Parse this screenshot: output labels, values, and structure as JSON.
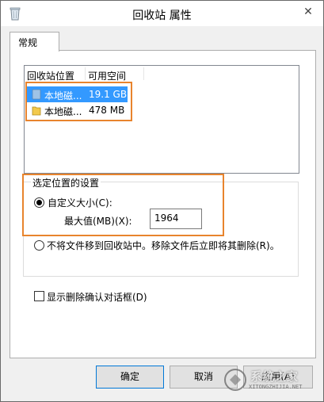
{
  "window": {
    "title": "回收站 属性",
    "close_glyph": "✕"
  },
  "tabs": [
    {
      "label": "常规"
    }
  ],
  "listview": {
    "columns": [
      "回收站位置",
      "可用空间"
    ],
    "rows": [
      {
        "name": "本地磁...",
        "free": "19.1 GB",
        "selected": true,
        "icon": "drive-icon"
      },
      {
        "name": "本地磁...",
        "free": "478 MB",
        "selected": false,
        "icon": "drive-icon"
      }
    ]
  },
  "settings": {
    "group_title": "选定位置的设置",
    "custom_size_label": "自定义大小(C):",
    "max_size_label": "最大值(MB)(X):",
    "max_size_value": "1964",
    "no_move_label": "不将文件移到回收站中。移除文件后立即将其删除(R)。",
    "custom_selected": true
  },
  "confirm_checkbox": {
    "label": "显示删除确认对话框(D)",
    "checked": false
  },
  "buttons": {
    "ok": "确定",
    "cancel": "取消",
    "apply": "应用(A)"
  },
  "watermark": {
    "text": "系统之家",
    "sub": "XITONGZHIJIA.NET"
  },
  "colors": {
    "selection": "#3399ff",
    "highlight_box": "#e8842d"
  }
}
